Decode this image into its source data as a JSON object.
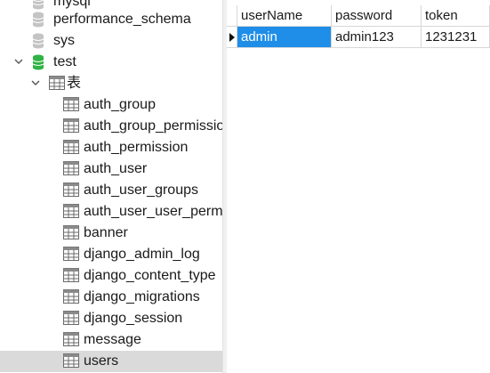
{
  "tree": {
    "databases": [
      {
        "name": "mysql"
      },
      {
        "name": "performance_schema"
      },
      {
        "name": "sys"
      },
      {
        "name": "test"
      }
    ],
    "tables_folder": "表",
    "tables": [
      "auth_group",
      "auth_group_permissio",
      "auth_permission",
      "auth_user",
      "auth_user_groups",
      "auth_user_user_permi",
      "banner",
      "django_admin_log",
      "django_content_type",
      "django_migrations",
      "django_session",
      "message",
      "users"
    ],
    "selected_table": "users"
  },
  "grid": {
    "columns": [
      "userName",
      "password",
      "token"
    ],
    "rows": [
      [
        "admin",
        "admin123",
        "1231231"
      ]
    ]
  },
  "colors": {
    "selected_cell": "#1e8ee8",
    "selected_tree_row": "#dadada",
    "db_active": "#2fb344",
    "db_inactive": "#b8b8b8"
  }
}
